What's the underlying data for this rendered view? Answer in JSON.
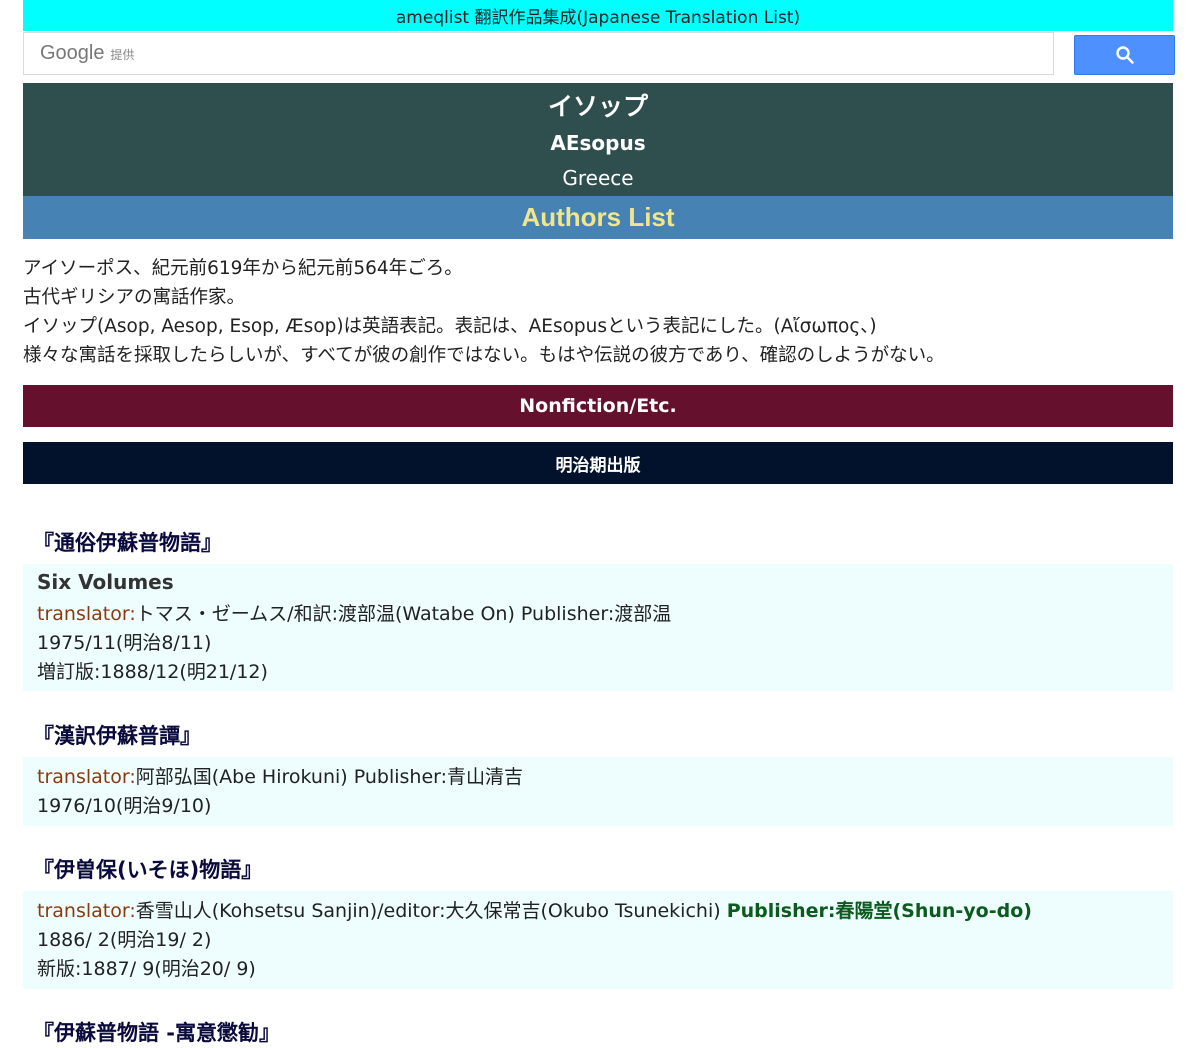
{
  "topbar": {
    "title": "ameqlist 翻訳作品集成(Japanese Translation List)"
  },
  "search": {
    "brand": "Google",
    "provided_label": "提供",
    "placeholder": "",
    "button_icon": "search-icon",
    "button_color": "#4d90fe"
  },
  "author": {
    "name_jp": "イソップ",
    "name_en": "AEsopus",
    "country": "Greece",
    "header_bg": "#2f4f4f"
  },
  "authors_list_link": {
    "label": "Authors List",
    "bg": "#4682b4",
    "color": "#f0e68c"
  },
  "intro": {
    "lines": [
      "アイソーポス、紀元前619年から紀元前564年ごろ。",
      "古代ギリシアの寓話作家。",
      "イソップ(Asop, Aesop, Esop, Æsop)は英語表記。表記は、AEsopusという表記にした。(Αἴσωπος、)",
      "様々な寓話を採取したらしいが、すべてが彼の創作ではない。もはや伝説の彼方であり、確認のしようがない。"
    ]
  },
  "sections": {
    "nonfiction": {
      "label": "Nonfiction/Etc.",
      "bg": "#65112d"
    },
    "meiji": {
      "label": "明治期出版",
      "bg": "#02112c"
    }
  },
  "works": [
    {
      "title": "『通俗伊蘇普物語』",
      "subtitle": "Six Volumes",
      "translator_label": "translator:",
      "credit": "トマス・ゼームス/和訳:渡部温(Watabe On) Publisher:渡部温",
      "dates": [
        "1975/11(明治8/11)",
        "増訂版:1888/12(明21/12)"
      ]
    },
    {
      "title": "『漢訳伊蘇普譚』",
      "translator_label": "translator:",
      "credit": "阿部弘国(Abe Hirokuni) Publisher:青山清吉",
      "dates": [
        "1976/10(明治9/10)"
      ]
    },
    {
      "title": "『伊曽保(いそほ)物語』",
      "translator_label": "translator:",
      "credit": "香雪山人(Kohsetsu Sanjin)/editor:大久保常吉(Okubo Tsunekichi) ",
      "publisher_strong": "Publisher:春陽堂(Shun-yo-do)",
      "dates": [
        "1886/ 2(明治19/ 2)",
        "新版:1887/ 9(明治20/ 9)"
      ]
    },
    {
      "title": "『伊蘇普物語 -寓意懲勧』"
    }
  ]
}
